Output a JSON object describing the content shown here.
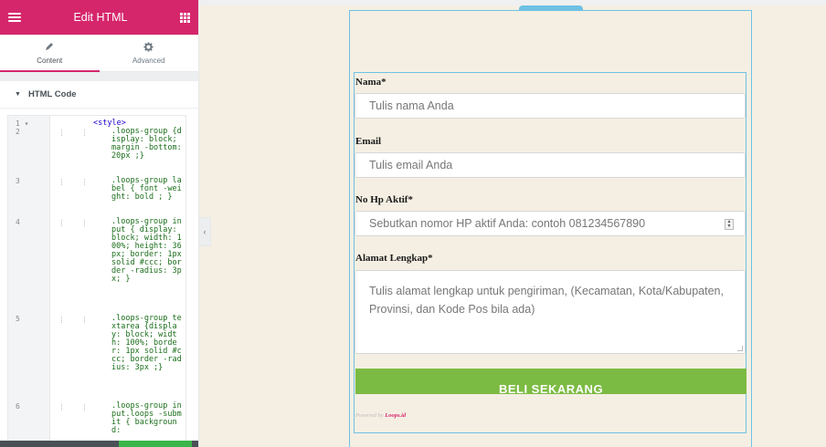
{
  "panel": {
    "title": "Edit HTML",
    "tabs": [
      {
        "label": "Content",
        "icon": "pencil-icon"
      },
      {
        "label": "Advanced",
        "icon": "gear-icon"
      }
    ],
    "section_title": "HTML Code",
    "code_lines": [
      {
        "num": "1",
        "fold": "▾",
        "text": "<style>"
      },
      {
        "num": "2",
        "text": ".loops-group {display: block; margin -bottom: 20px ;}"
      },
      {
        "num": "3",
        "text": ".loops-group label { font -weight: bold ; }"
      },
      {
        "num": "4",
        "text": ".loops-group input { display: block; width: 100%; height: 36px; border: 1px solid #ccc; border -radius: 3px; }"
      },
      {
        "num": "5",
        "text": ".loops-group textarea {display: block; width: 100%; border: 1px solid #ccc; border -radius: 3px ;}"
      },
      {
        "num": "6",
        "text": ".loops-group input.loops -submit { background:"
      }
    ]
  },
  "form": {
    "fields": [
      {
        "label": "Nama*",
        "placeholder": "Tulis nama Anda"
      },
      {
        "label": "Email",
        "placeholder": "Tulis email Anda"
      },
      {
        "label": "No Hp Aktif*",
        "placeholder": "Sebutkan nomor HP aktif Anda: contoh 081234567890"
      }
    ],
    "address_label": "Alamat Lengkap*",
    "address_placeholder": "Tulis alamat lengkap untuk pengiriman, (Kecamatan, Kota/Kabupaten, Provinsi, dan Kode Pos bila ada)",
    "submit_label": "BELI SEKARANG",
    "powered_prefix": "Powered by",
    "powered_brand": "Loops.id"
  },
  "colors": {
    "accent": "#d5266c",
    "button": "#7cbb43",
    "frame": "#6ec1e4",
    "canvas": "#f5efe3"
  }
}
